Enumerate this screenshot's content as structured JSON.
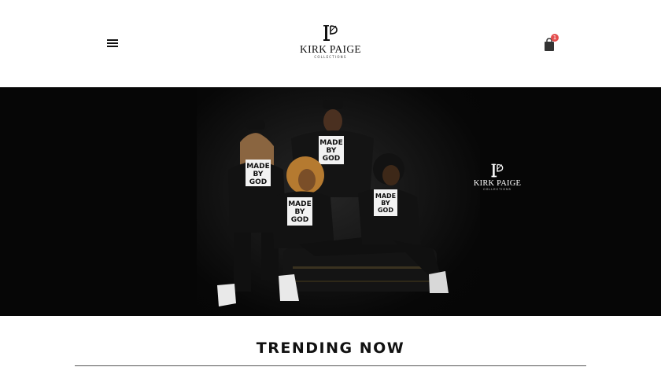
{
  "header": {
    "menu_icon": "hamburger-menu-icon",
    "logo": {
      "monogram": "KP",
      "name": "KIRK PAIGE",
      "tagline": "COLLECTIONS"
    },
    "cart": {
      "icon": "shopping-bag-icon",
      "count": "1"
    }
  },
  "hero": {
    "shirt_text": [
      "MADE",
      "BY",
      "GOD"
    ],
    "logo": {
      "name": "KIRK PAIGE",
      "tagline": "COLLECTIONS"
    }
  },
  "trending": {
    "title": "TRENDING NOW"
  },
  "colors": {
    "accent_badge": "#e44d4d",
    "hero_bg": "#060606",
    "text": "#111111"
  }
}
